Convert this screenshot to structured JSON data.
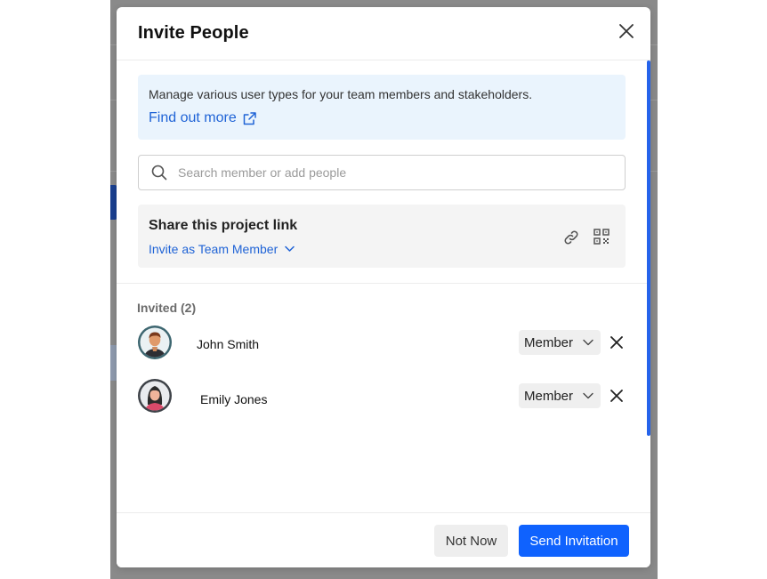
{
  "modal": {
    "title": "Invite People"
  },
  "info": {
    "text": "Manage various user types for your team members and stakeholders.",
    "link_label": "Find out more"
  },
  "search": {
    "placeholder": "Search member or add people",
    "value": ""
  },
  "share": {
    "title": "Share this project link",
    "role_label": "Invite as Team Member"
  },
  "invited": {
    "label": "Invited (2)",
    "people": [
      {
        "name": "John Smith",
        "role": "Member",
        "avatar": "male-avatar-icon"
      },
      {
        "name": "Emily Jones",
        "role": "Member",
        "avatar": "female-avatar-icon"
      }
    ]
  },
  "footer": {
    "not_now_label": "Not Now",
    "send_label": "Send Invitation"
  },
  "colors": {
    "accent": "#0f62fe",
    "link": "#1f63d6",
    "info_bg": "#eaf4fd",
    "backdrop": "#8a8a8a"
  }
}
